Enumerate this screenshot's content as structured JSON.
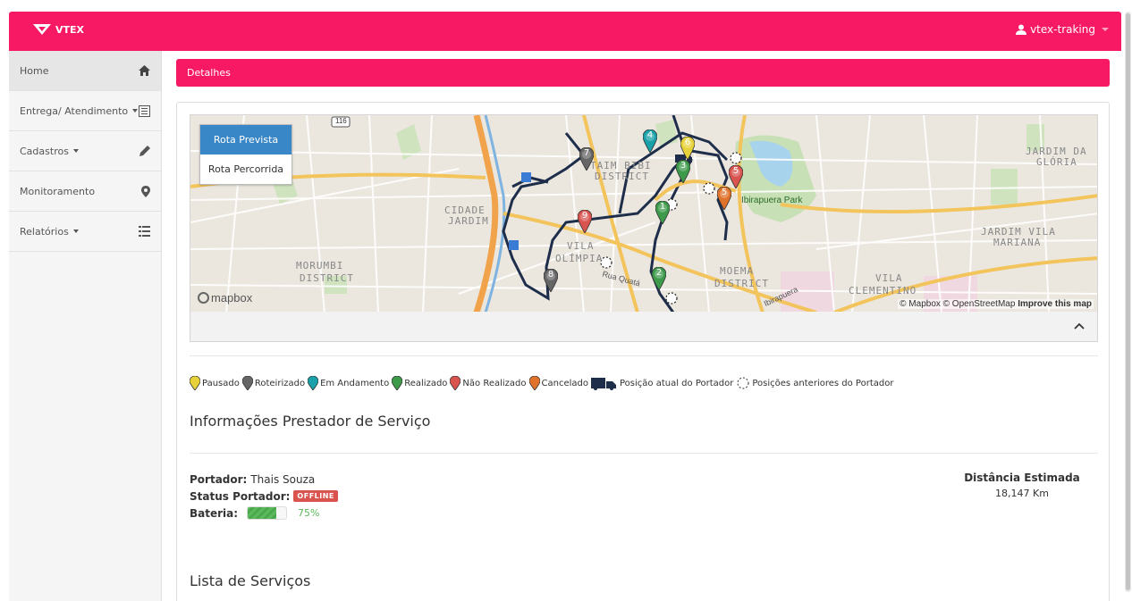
{
  "app": {
    "brand": "VTEX",
    "user": "vtex-traking"
  },
  "sidebar": {
    "items": [
      {
        "label": "Home",
        "icon": "home-icon",
        "dropdown": false
      },
      {
        "label": "Entrega/ Atendimento",
        "icon": "list-alt-icon",
        "dropdown": true
      },
      {
        "label": "Cadastros",
        "icon": "pencil-icon",
        "dropdown": true
      },
      {
        "label": "Monitoramento",
        "icon": "map-marker-icon",
        "dropdown": false
      },
      {
        "label": "Relatórios",
        "icon": "list-icon",
        "dropdown": true
      }
    ]
  },
  "panel": {
    "title": "Detalhes"
  },
  "map": {
    "buttons": {
      "planned": "Rota Prevista",
      "traveled": "Rota Percorrida"
    },
    "labels": [
      "JARDIM DA",
      "GLÓRIA",
      "TAIM BIBI",
      "DISTRICT",
      "CIDADE",
      "JARDIM",
      "Ibirapuera Park",
      "JARDIM VILA",
      "MARIANA",
      "VILA",
      "OLÍMPIA",
      "MORUMBI",
      "DISTRICT",
      "MOEMA",
      "DISTRICT",
      "VILA",
      "CLEMENTINO",
      "Rua Quatá",
      "Ibirapuera",
      "116"
    ],
    "attribution": "© Mapbox © OpenStreetMap",
    "improve": "Improve this map",
    "logo": "mapbox",
    "markers": [
      {
        "n": "1",
        "status": "Realizado"
      },
      {
        "n": "2",
        "status": "Realizado"
      },
      {
        "n": "3",
        "status": "Realizado"
      },
      {
        "n": "4",
        "status": "Em Andamento"
      },
      {
        "n": "5",
        "status": "Cancelado"
      },
      {
        "n": "5",
        "status": "Não Realizado"
      },
      {
        "n": "6",
        "status": "Pausado"
      },
      {
        "n": "7",
        "status": "Roteirizado"
      },
      {
        "n": "8",
        "status": "Roteirizado"
      },
      {
        "n": "9",
        "status": "Não Realizado"
      }
    ]
  },
  "legend": [
    {
      "label": "Pausado",
      "color": "#e8d23a"
    },
    {
      "label": "Roteirizado",
      "color": "#666666"
    },
    {
      "label": "Em Andamento",
      "color": "#1aa0a8"
    },
    {
      "label": "Realizado",
      "color": "#3c9a4a"
    },
    {
      "label": "Não Realizado",
      "color": "#d9534f"
    },
    {
      "label": "Cancelado",
      "color": "#e0722c"
    },
    {
      "label": "Posição atual do Portador",
      "icon": "truck-icon"
    },
    {
      "label": "Posições anteriores do Portador",
      "icon": "dashed-circle-icon"
    }
  ],
  "provider": {
    "title": "Informações Prestador de Serviço",
    "carrier_label": "Portador:",
    "carrier_name": "Thais Souza",
    "status_label": "Status Portador:",
    "status_value": "OFFLINE",
    "battery_label": "Bateria:",
    "battery_level": 0.75,
    "battery_text": "75%",
    "distance_label": "Distância Estimada",
    "distance_value": "18,147 Km"
  },
  "services": {
    "title": "Lista de Serviços"
  },
  "colors": {
    "brand": "#f71963",
    "active_button": "#3a87c8",
    "offline": "#d9534f",
    "battery": "#5cb85c"
  }
}
